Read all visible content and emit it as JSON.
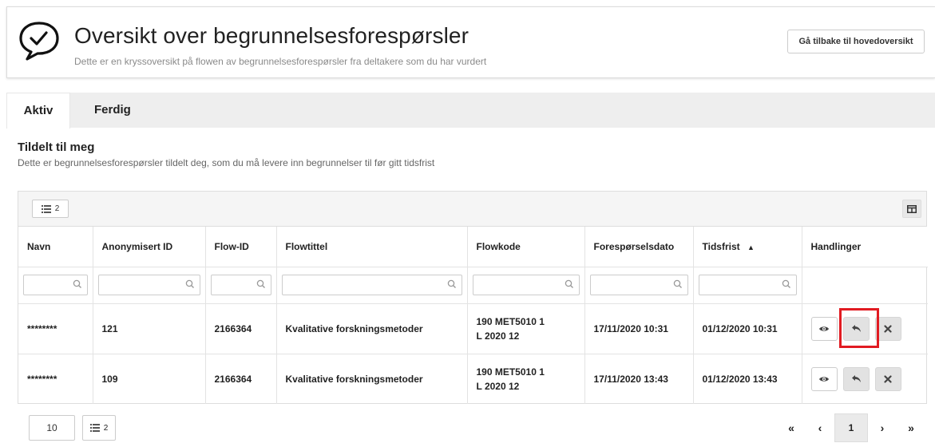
{
  "header": {
    "title": "Oversikt over begrunnelsesforespørsler",
    "subtitle": "Dette er en kryssoversikt på flowen av begrunnelsesforespørsler fra deltakere som du har vurdert",
    "back_button": "Gå tilbake til hovedoversikt",
    "logo_icon": "chat-check-icon"
  },
  "tabs": [
    {
      "label": "Aktiv",
      "active": true
    },
    {
      "label": "Ferdig",
      "active": false
    }
  ],
  "section": {
    "title": "Tildelt til meg",
    "description": "Dette er begrunnelsesforespørsler tildelt deg, som du må levere inn begrunnelser til før gitt tidsfrist"
  },
  "toolbar": {
    "columns_count": "2",
    "columns_icon": "list-icon",
    "layout_icon": "layout-icon"
  },
  "table": {
    "columns": [
      "Navn",
      "Anonymisert ID",
      "Flow-ID",
      "Flowtittel",
      "Flowkode",
      "Forespørselsdato",
      "Tidsfrist",
      "Handlinger"
    ],
    "sorted_column": "Tidsfrist",
    "sort_direction": "asc",
    "filter_placeholder": "",
    "rows": [
      {
        "navn": "********",
        "anon_id": "121",
        "flow_id": "2166364",
        "flowtittel": "Kvalitative forskningsmetoder",
        "flowkode_line1": "190 MET5010 1",
        "flowkode_line2": "L 2020 12",
        "forespørselsdato": "17/11/2020 10:31",
        "tidsfrist": "01/12/2020 10:31"
      },
      {
        "navn": "********",
        "anon_id": "109",
        "flow_id": "2166364",
        "flowtittel": "Kvalitative forskningsmetoder",
        "flowkode_line1": "190 MET5010 1",
        "flowkode_line2": "L 2020 12",
        "forespørselsdato": "17/11/2020 13:43",
        "tidsfrist": "01/12/2020 13:43"
      }
    ],
    "action_icons": [
      "eye-icon",
      "reply-icon",
      "close-icon"
    ]
  },
  "footer": {
    "page_size": "10",
    "columns_count": "2",
    "pager": {
      "first": "«",
      "prev": "‹",
      "current": "1",
      "next": "›",
      "last": "»"
    }
  },
  "colors": {
    "highlight": "#e11b22",
    "tabbar_bg": "#eeeeee",
    "action_bg": "#e2e2e2"
  }
}
